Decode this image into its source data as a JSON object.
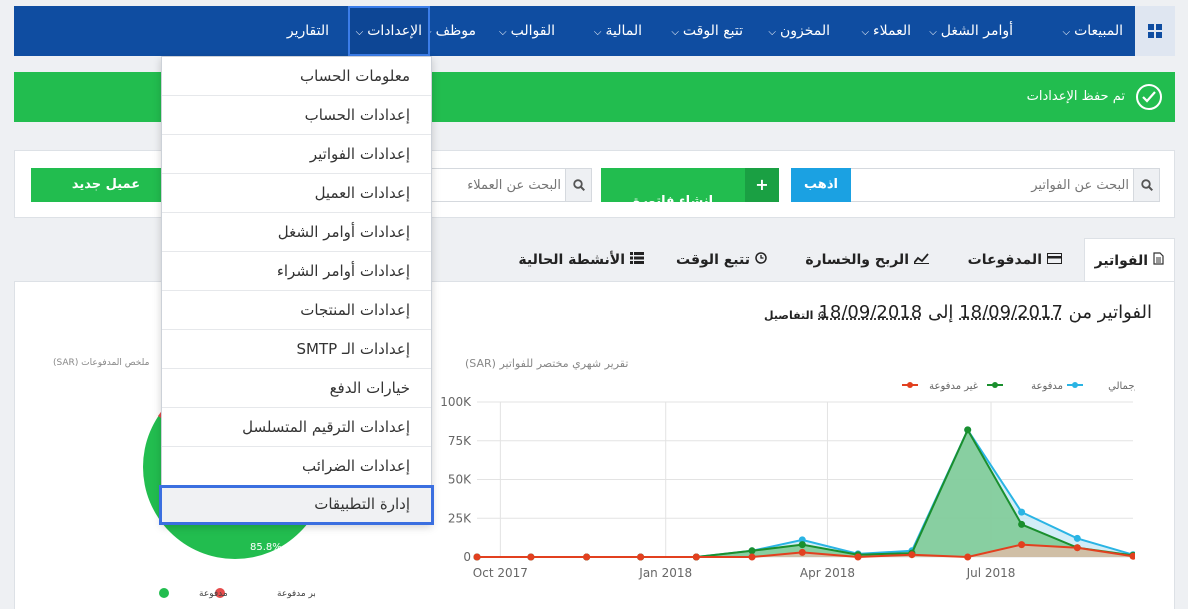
{
  "nav": {
    "items": [
      {
        "label": "المبيعات",
        "caret": true
      },
      {
        "label": "أوامر الشغل",
        "caret": true
      },
      {
        "label": "العملاء",
        "caret": true
      },
      {
        "label": "المخزون",
        "caret": true
      },
      {
        "label": "تتبع الوقت",
        "caret": true
      },
      {
        "label": "المالية",
        "caret": true
      },
      {
        "label": "القوالب",
        "caret": true
      },
      {
        "label": "موظف",
        "caret": true
      },
      {
        "label": "الإعدادات",
        "caret": true
      },
      {
        "label": "التقارير",
        "caret": false
      }
    ],
    "caret_glyph": "⌵",
    "menu_icon": "grid-icon",
    "bar_color": "#0f4da1"
  },
  "banner": {
    "text": "تم حفظ الإعدادات",
    "icon": "check-circle-icon",
    "color": "#22bd4f"
  },
  "search": {
    "invoice_placeholder": "البحث عن الفواتير",
    "go_label": "اذهب",
    "new_invoice_label": "إنشاء فاتورة",
    "new_invoice_plus": "+",
    "client_placeholder": "البحث عن العملاء",
    "new_client_label": "عميل جديد"
  },
  "tabs": [
    {
      "label": "الفواتير",
      "icon": "document-icon"
    },
    {
      "label": "المدفوعات",
      "icon": "credit-card-icon"
    },
    {
      "label": "الربح والخسارة",
      "icon": "line-chart-icon"
    },
    {
      "label": "تتبع الوقت",
      "icon": "clock-icon"
    },
    {
      "label": "الأنشطة الحالية",
      "icon": "list-icon"
    }
  ],
  "range": {
    "prefix": "الفواتير من",
    "from": "18/09/2017",
    "middle": "إلى",
    "to": "18/09/2018",
    "details_label": "التفاصيل",
    "details_icon": "gear-icon"
  },
  "pie": {
    "title": "ملخص المدفوعات (SAR)",
    "paid_pct_label": "85.8%",
    "legend_paid": "مدفوعة",
    "legend_unpaid": "غير مدفوعة"
  },
  "dropdown": {
    "items": [
      "معلومات الحساب",
      "إعدادات الحساب",
      "إعدادات الفواتير",
      "إعدادات العميل",
      "إعدادات أوامر الشغل",
      "إعدادات أوامر الشراء",
      "إعدادات المنتجات",
      "إعدادات الـ SMTP",
      "خيارات الدفع",
      "إعدادات الترقيم المتسلسل",
      "إعدادات الضرائب",
      "إدارة التطبيقات"
    ],
    "highlighted_index": 11
  },
  "chart_data": {
    "type": "area",
    "title": "تقرير شهري مختصر للفواتير (SAR)",
    "x_ticks": [
      "Oct 2017",
      "Jan 2018",
      "Apr 2018",
      "Jul 2018"
    ],
    "y_ticks": [
      "0",
      "25K",
      "50K",
      "75K",
      "100K"
    ],
    "ylim": [
      0,
      100000
    ],
    "x_points": [
      "2017-09-18",
      "2017-10-18",
      "2017-11-18",
      "2017-12-18",
      "2018-01-18",
      "2018-02-18",
      "2018-03-18",
      "2018-04-18",
      "2018-05-18",
      "2018-06-18",
      "2018-07-18",
      "2018-08-18",
      "2018-09-18"
    ],
    "legend": [
      "الإجمالي",
      "مدفوعة",
      "غير مدفوعة"
    ],
    "series": [
      {
        "name": "الإجمالي",
        "color": "#2ab4e4",
        "fill": "#bfe6f4",
        "values": [
          0,
          0,
          0,
          0,
          0,
          4000,
          11000,
          2000,
          4000,
          82000,
          29000,
          12000,
          1500
        ]
      },
      {
        "name": "مدفوعة",
        "color": "#1a8f2e",
        "fill": "#7fcb97",
        "values": [
          0,
          0,
          0,
          0,
          0,
          4000,
          8000,
          1500,
          2500,
          82000,
          21000,
          6000,
          1000
        ]
      },
      {
        "name": "غير مدفوعة",
        "color": "#e2401f",
        "fill": "#f0b8a8",
        "values": [
          0,
          0,
          0,
          0,
          0,
          0,
          3000,
          0,
          1500,
          0,
          8000,
          6000,
          500
        ]
      }
    ],
    "grid": true,
    "legend_position": "top-right"
  }
}
